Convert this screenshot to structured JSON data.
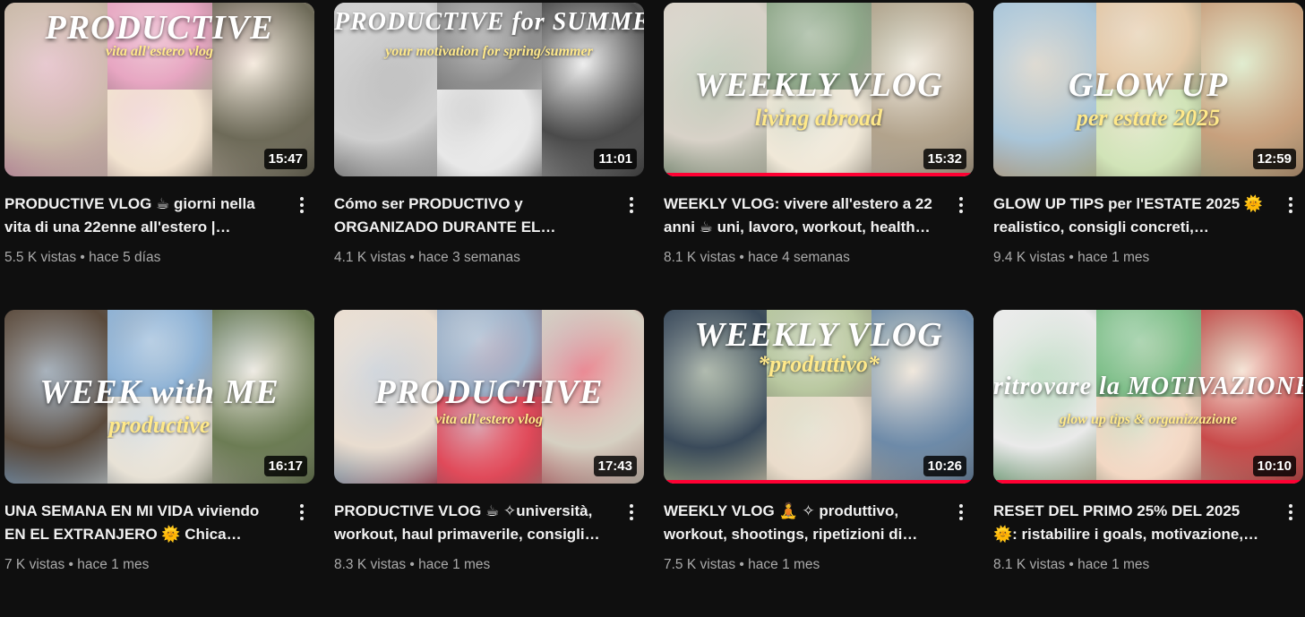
{
  "videos": [
    {
      "title": "PRODUCTIVE VLOG ☕ giorni nella vita di una 22enne all'estero |…",
      "views": "5.5 K vistas",
      "age": "hace 5 días",
      "duration": "15:47",
      "overlay": "PRODUCTIVE",
      "overlay2": "vita all'estero  vlog",
      "colors": [
        "#c9b8a7",
        "#e7a6c2",
        "#f2e3d0",
        "#6d6a58"
      ],
      "progress": 0
    },
    {
      "title": "Cómo ser PRODUCTIVO y ORGANIZADO DURANTE EL…",
      "views": "4.1 K vistas",
      "age": "hace 3 semanas",
      "duration": "11:01",
      "overlay": "PRODUCTIVE for SUMMER",
      "overlay2": "your motivation for spring/summer",
      "colors": [
        "#cfcfcf",
        "#8f8f8f",
        "#e8e8e8",
        "#4a4a4a"
      ],
      "progress": 0
    },
    {
      "title": "WEEKLY VLOG: vivere all'estero a 22 anni ☕ uni, lavoro, workout, health…",
      "views": "8.1 K vistas",
      "age": "hace 4 semanas",
      "duration": "15:32",
      "overlay": "WEEKLY VLOG",
      "overlay2": "living abroad",
      "colors": [
        "#d8d2c8",
        "#8fa88a",
        "#f0e8d8",
        "#b2a38c"
      ],
      "progress": 1.0
    },
    {
      "title": "GLOW UP TIPS per l'ESTATE 2025 🌞 realistico, consigli concreti,…",
      "views": "9.4 K vistas",
      "age": "hace 1 mes",
      "duration": "12:59",
      "overlay": "GLOW UP",
      "overlay2": "per estate 2025",
      "colors": [
        "#a9c5d8",
        "#e4c9a8",
        "#d1e4b8",
        "#c7a07d"
      ],
      "progress": 0
    },
    {
      "title": "UNA SEMANA EN MI VIDA viviendo EN EL EXTRANJERO 🌞 Chica…",
      "views": "7 K vistas",
      "age": "hace 1 mes",
      "duration": "16:17",
      "overlay": "WEEK with ME",
      "overlay2": "productive",
      "colors": [
        "#5a4a3c",
        "#8fb3d6",
        "#e8e2d6",
        "#6c7c54"
      ],
      "progress": 0
    },
    {
      "title": "PRODUCTIVE VLOG ☕ ✧università, workout, haul primaverile, consigli…",
      "views": "8.3 K vistas",
      "age": "hace 1 mes",
      "duration": "17:43",
      "overlay": "PRODUCTIVE",
      "overlay2": "vita all'estero  vlog",
      "colors": [
        "#e9ddd0",
        "#9bb0c8",
        "#e04a5a",
        "#d6d0c2"
      ],
      "progress": 0
    },
    {
      "title": "WEEKLY VLOG 🧘 ✧ produttivo, workout, shootings, ripetizioni di…",
      "views": "7.5 K vistas",
      "age": "hace 1 mes",
      "duration": "10:26",
      "overlay": "WEEKLY VLOG",
      "overlay2": "*produttivo*",
      "colors": [
        "#3a4a5a",
        "#b9c8a0",
        "#eadccb",
        "#6d8aa8"
      ],
      "progress": 1.0
    },
    {
      "title": "RESET DEL PRIMO 25% DEL 2025 🌞: ristabilire i goals, motivazione,…",
      "views": "8.1 K vistas",
      "age": "hace 1 mes",
      "duration": "10:10",
      "overlay": "ritrovare la MOTIVAZIONE",
      "overlay2": "glow up tips & organizzazione",
      "colors": [
        "#eaeaea",
        "#7fbf8a",
        "#f3d8c4",
        "#c84a4a"
      ],
      "progress": 1.0
    }
  ]
}
